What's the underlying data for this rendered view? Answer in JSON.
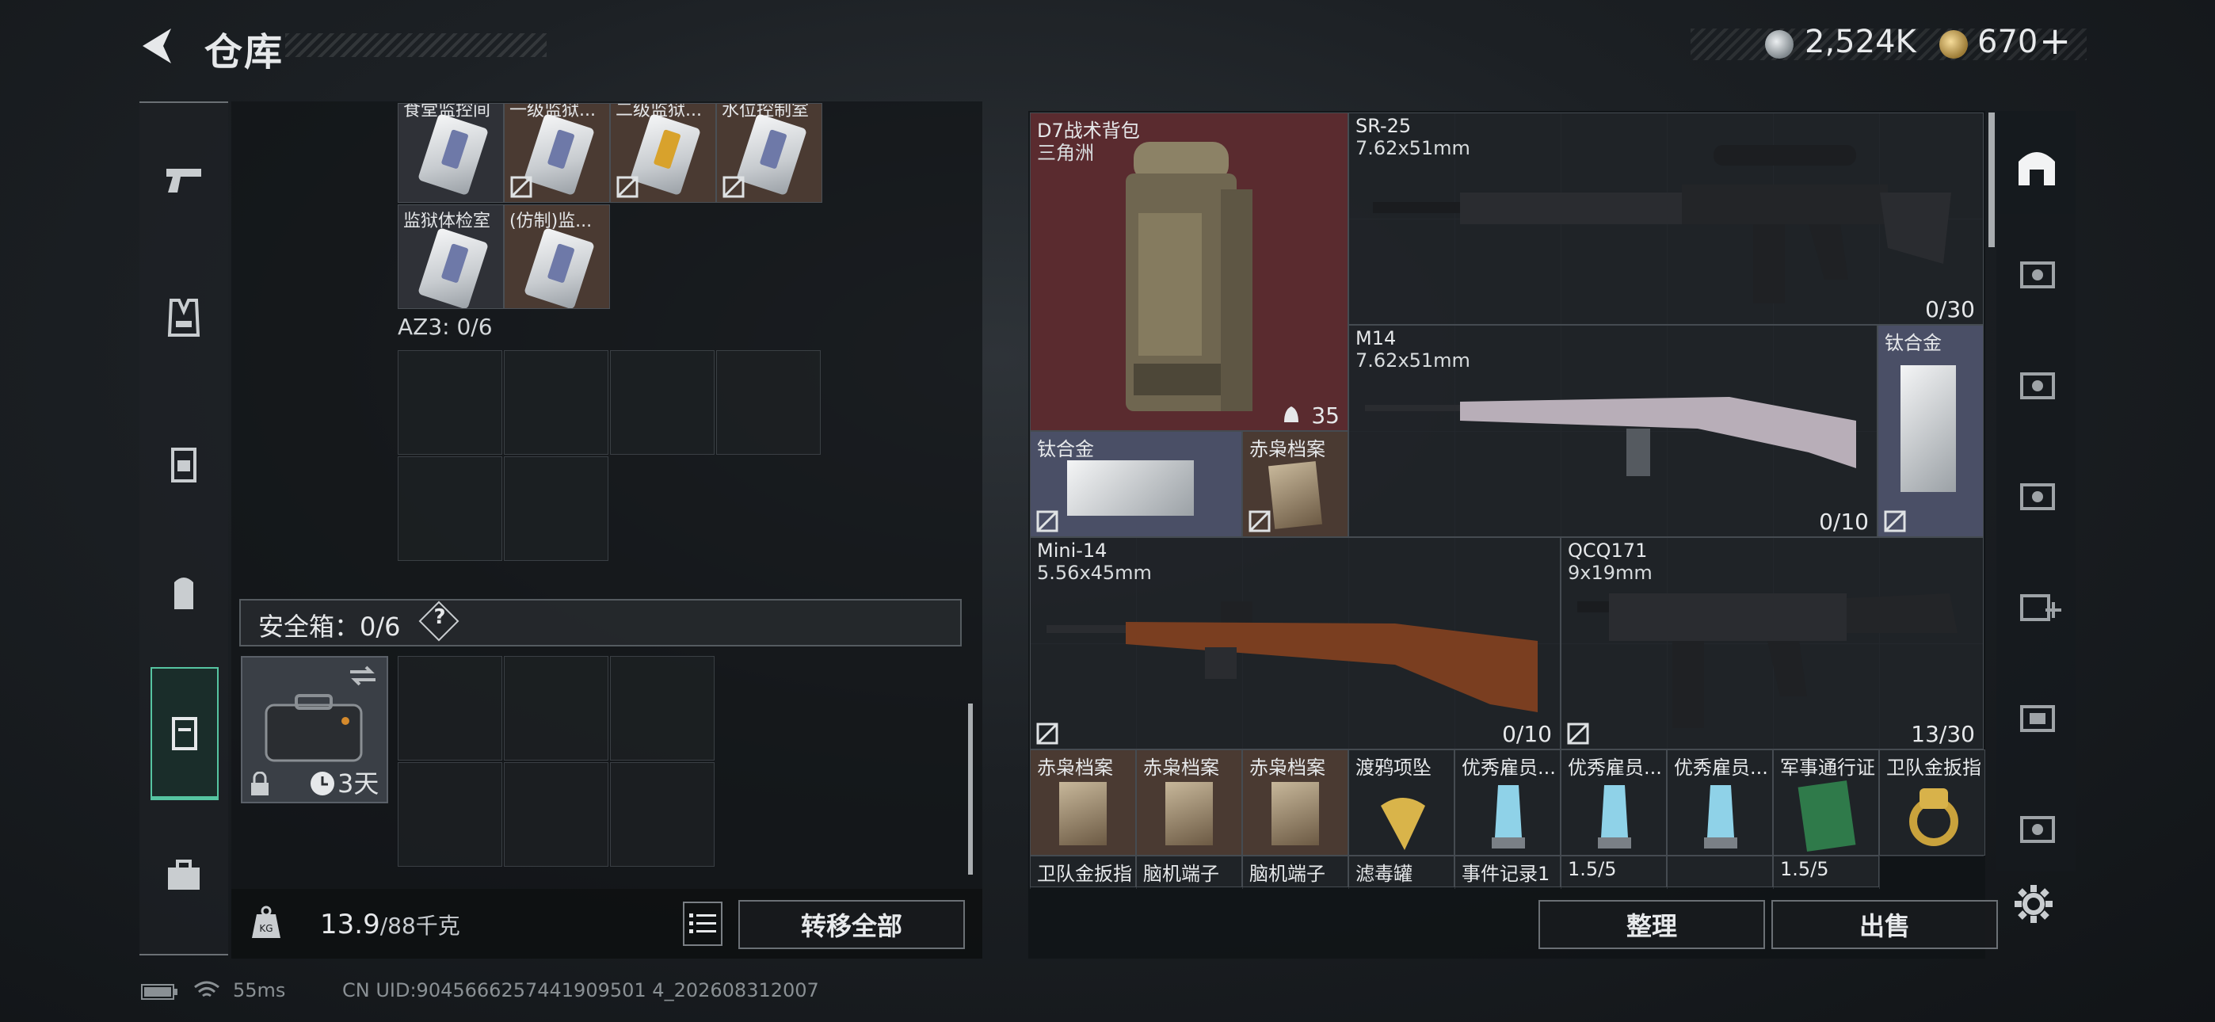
{
  "header": {
    "title": "仓库"
  },
  "currency": {
    "silver": "2,524K",
    "gold": "670",
    "gold_plus": "+"
  },
  "nav": [
    "weapons",
    "armor",
    "chest-rig",
    "backpack",
    "safe-box",
    "toolbox"
  ],
  "left": {
    "top_items": [
      {
        "label": "食堂监控间"
      },
      {
        "label": "一级监狱..."
      },
      {
        "label": "二级监狱..."
      },
      {
        "label": "水位控制室"
      },
      {
        "label": "监狱体检室"
      },
      {
        "label": "(仿制)监..."
      }
    ],
    "az3_label": "AZ3: 0/6",
    "safe_label": "安全箱：0/6",
    "help": "?",
    "safe_case_days": "3天",
    "weight": "13.9",
    "weight_unit": "/88千克",
    "transfer_all": "转移全部"
  },
  "right": {
    "backpack": {
      "name": "D7战术背包",
      "sub": "三角洲",
      "count": "35"
    },
    "sr25": {
      "name": "SR-25",
      "caliber": "7.62x51mm",
      "ammo": "0/30"
    },
    "m14": {
      "name": "M14",
      "caliber": "7.62x51mm",
      "ammo": "0/10"
    },
    "ti1": {
      "name": "钛合金"
    },
    "ti2": {
      "name": "钛合金"
    },
    "file1": {
      "name": "赤枭档案"
    },
    "mini14": {
      "name": "Mini-14",
      "caliber": "5.56x45mm",
      "ammo": "0/10"
    },
    "qcq": {
      "name": "QCQ171",
      "caliber": "9x19mm",
      "ammo": "13/30"
    },
    "row4": [
      {
        "label": "赤枭档案"
      },
      {
        "label": "赤枭档案"
      },
      {
        "label": "赤枭档案"
      },
      {
        "label": "渡鸦项坠"
      },
      {
        "label": "优秀雇员..."
      },
      {
        "label": "优秀雇员..."
      },
      {
        "label": "优秀雇员..."
      },
      {
        "label": "军事通行证"
      },
      {
        "label": "卫队金扳指"
      }
    ],
    "row5": [
      {
        "label": "卫队金扳指"
      },
      {
        "label": "脑机端子"
      },
      {
        "label": "脑机端子"
      },
      {
        "label": "滤毒罐"
      },
      {
        "label": "事件记录1"
      },
      {
        "label": "1.5/5"
      },
      {
        "label": ""
      },
      {
        "label": "1.5/5"
      }
    ],
    "sort_btn": "整理",
    "sell_btn": "出售"
  },
  "status": {
    "ping": "55ms",
    "uid": "CN UID:9045666257441909501 4_202608312007"
  }
}
